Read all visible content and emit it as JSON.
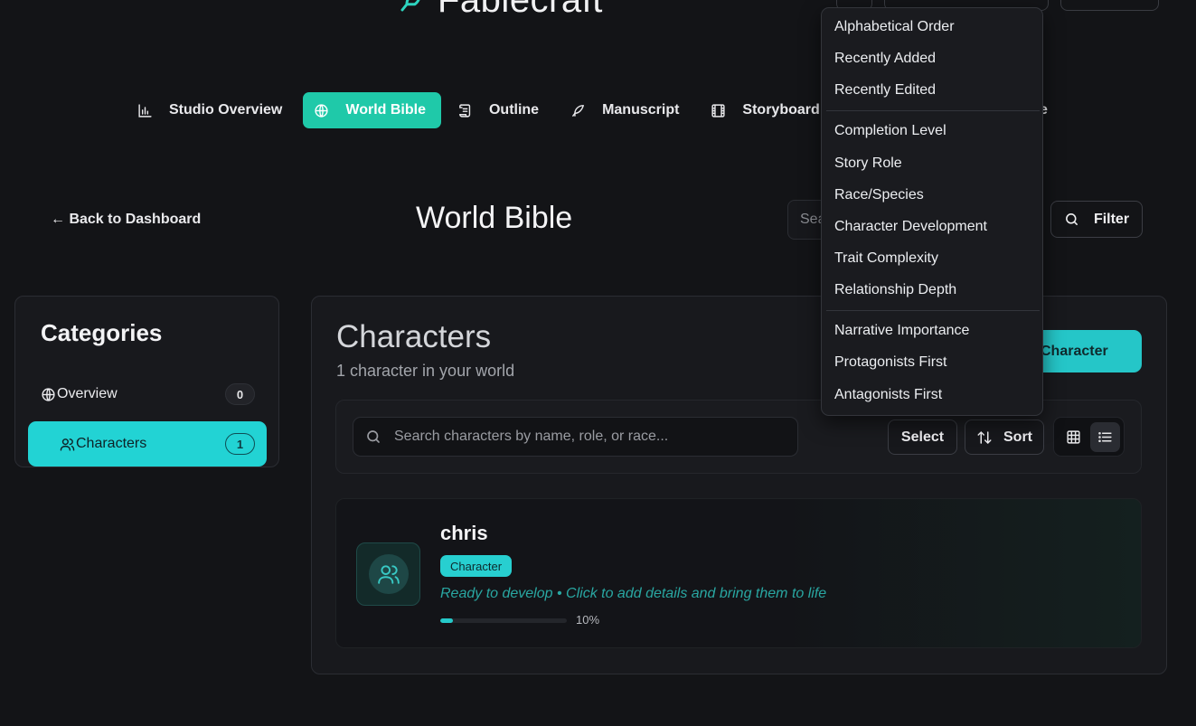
{
  "brand": {
    "name": "Fablecraft"
  },
  "nav": {
    "items": [
      {
        "label": "Studio Overview",
        "icon": "bar-chart-icon",
        "active": false
      },
      {
        "label": "World Bible",
        "icon": "globe-icon",
        "active": true
      },
      {
        "label": "Outline",
        "icon": "scroll-icon",
        "active": false
      },
      {
        "label": "Manuscript",
        "icon": "feather-icon",
        "active": false
      },
      {
        "label": "Storyboard",
        "icon": "film-icon",
        "active": false
      }
    ],
    "hidden_tail": "e"
  },
  "header": {
    "back_label": "← Back to Dashboard",
    "title": "World Bible",
    "search_placeholder": "Sea",
    "filter_label": "Filter"
  },
  "categories": {
    "title": "Categories",
    "items": [
      {
        "label": "Overview",
        "count": "0",
        "icon": "globe-icon",
        "active": false
      },
      {
        "label": "Characters",
        "count": "1",
        "icon": "users-icon",
        "active": true
      }
    ]
  },
  "main": {
    "title": "Characters",
    "subtitle": "1 character in your world",
    "add_button_label": "Character",
    "search_placeholder": "Search characters by name, role, or race...",
    "select_label": "Select",
    "sort_label": "Sort"
  },
  "character_card": {
    "name": "chris",
    "badge": "Character",
    "hint": "Ready to develop • Click to add details and bring them to life",
    "progress_label": "10%",
    "progress_value": 10
  },
  "sort_menu": {
    "items": [
      "Alphabetical Order",
      "Recently Added",
      "Recently Edited",
      "Completion Level",
      "Story Role",
      "Race/Species",
      "Character Development",
      "Trait Complexity",
      "Relationship Depth",
      "Narrative Importance",
      "Protagonists First",
      "Antagonists First"
    ]
  },
  "colors": {
    "background": "#131417",
    "accent": "#22d3d4",
    "nav_active": "#1fc9a9",
    "panel": "#18191d"
  }
}
